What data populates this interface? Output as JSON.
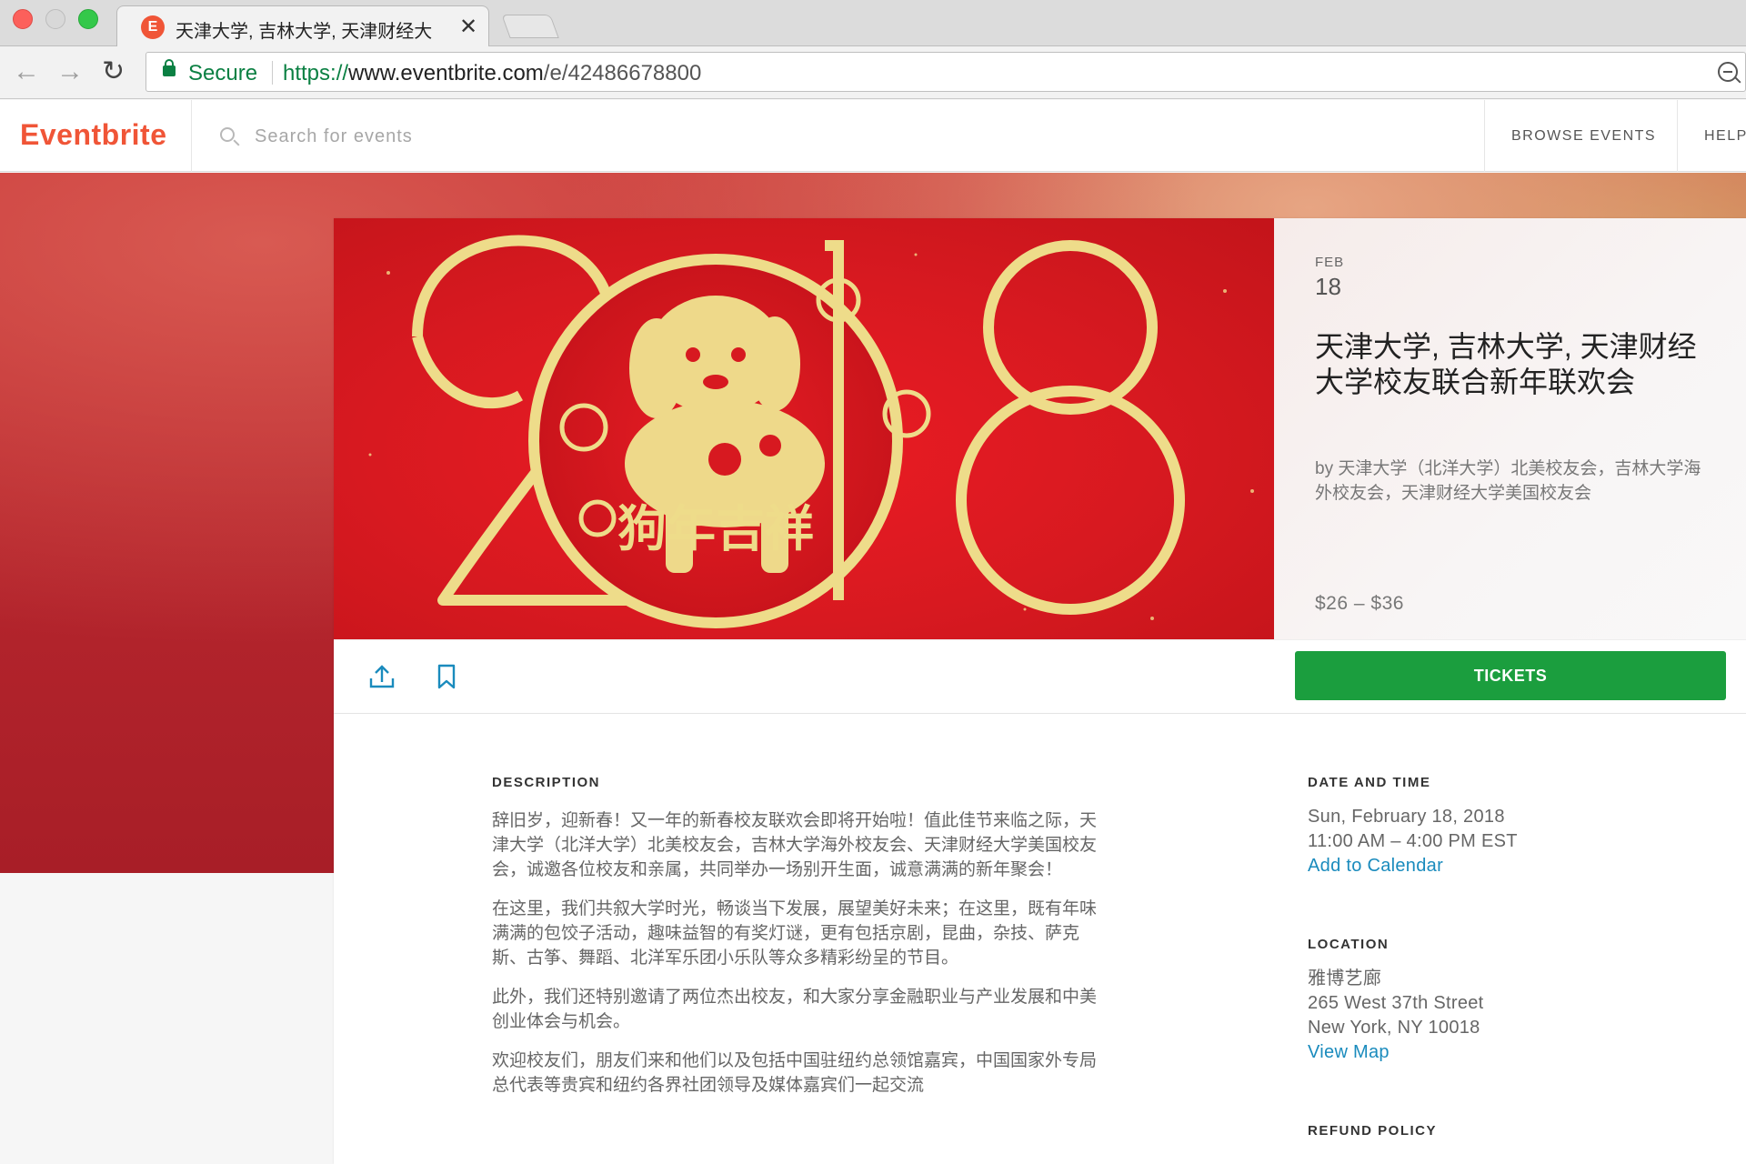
{
  "browser": {
    "tab_title": "天津大学, 吉林大学, 天津财经大",
    "tab_favicon": "E",
    "secure_label": "Secure",
    "url_scheme": "https://",
    "url_host": "www.eventbrite.com",
    "url_path": "/e/42486678800"
  },
  "header": {
    "logo": "Eventbrite",
    "search_placeholder": "Search for events",
    "nav": [
      "BROWSE EVENTS",
      "HELP"
    ]
  },
  "event": {
    "month": "FEB",
    "day": "18",
    "title": "天津大学, 吉林大学, 天津财经大学校友联合新年联欢会",
    "organizer": "by 天津大学（北洋大学）北美校友会，吉林大学海外校友会，天津财经大学美国校友会",
    "price": "$26 – $36",
    "banner_year": "2018",
    "banner_caption": "狗年吉祥",
    "tickets_label": "TICKETS"
  },
  "description": {
    "heading": "DESCRIPTION",
    "paragraphs": [
      "辞旧岁，迎新春！又一年的新春校友联欢会即将开始啦！值此佳节来临之际，天津大学（北洋大学）北美校友会，吉林大学海外校友会、天津财经大学美国校友会，诚邀各位校友和亲属，共同举办一场别开生面，诚意满满的新年聚会！",
      "在这里，我们共叙大学时光，畅谈当下发展，展望美好未来；在这里，既有年味满满的包饺子活动，趣味益智的有奖灯谜，更有包括京剧，昆曲，杂技、萨克斯、古筝、舞蹈、北洋军乐团小乐队等众多精彩纷呈的节目。",
      "此外，我们还特别邀请了两位杰出校友，和大家分享金融职业与产业发展和中美创业体会与机会。",
      "欢迎校友们，朋友们来和他们以及包括中国驻纽约总领馆嘉宾，中国国家外专局总代表等贵宾和纽约各界社团领导及媒体嘉宾们一起交流"
    ]
  },
  "date_time": {
    "heading": "DATE AND TIME",
    "date": "Sun, February 18, 2018",
    "time": "11:00 AM – 4:00 PM EST",
    "add_calendar": "Add to Calendar"
  },
  "location": {
    "heading": "LOCATION",
    "venue": "雅博艺廊",
    "street": "265 West 37th Street",
    "city": "New York, NY 10018",
    "map_link": "View Map"
  },
  "refund": {
    "heading": "REFUND POLICY"
  },
  "colors": {
    "brand": "#f05537",
    "tickets_green": "#1b9e3e",
    "banner_red": "#d71920",
    "banner_gold": "#eedc8a",
    "link_blue": "#1a8bbd"
  },
  "icons": [
    "lock-icon",
    "search-icon",
    "share-icon",
    "bookmark-icon",
    "zoom-icon",
    "close-icon"
  ]
}
